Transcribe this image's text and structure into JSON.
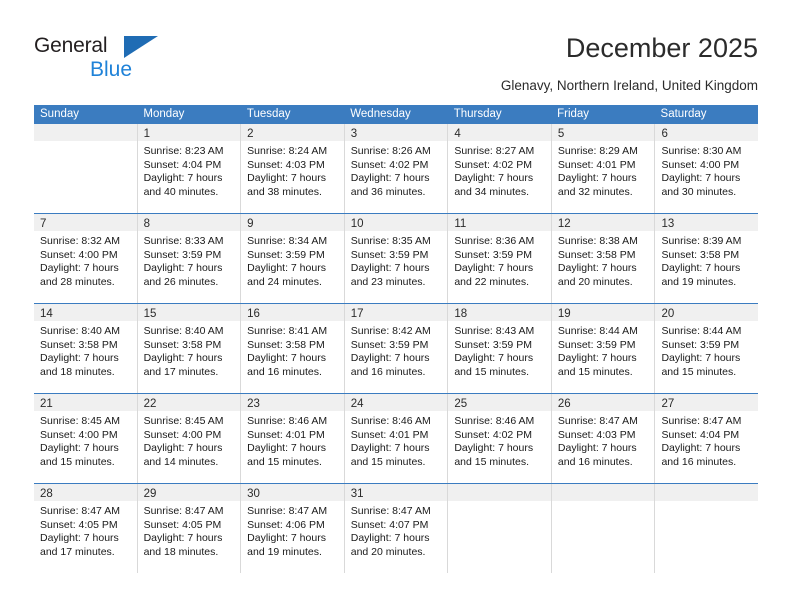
{
  "brand": {
    "name_part1": "General",
    "name_part2": "Blue",
    "primary_color": "#1f6cb4",
    "accent_color": "#1f82d8"
  },
  "header": {
    "title": "December 2025",
    "location": "Glenavy, Northern Ireland, United Kingdom"
  },
  "calendar": {
    "header_bg": "#3b7cc0",
    "header_text_color": "#ffffff",
    "daynum_bg": "#f0f0f0",
    "weekdays": [
      "Sunday",
      "Monday",
      "Tuesday",
      "Wednesday",
      "Thursday",
      "Friday",
      "Saturday"
    ],
    "weeks": [
      [
        {
          "day": "",
          "lines": []
        },
        {
          "day": "1",
          "lines": [
            "Sunrise: 8:23 AM",
            "Sunset: 4:04 PM",
            "Daylight: 7 hours",
            "and 40 minutes."
          ]
        },
        {
          "day": "2",
          "lines": [
            "Sunrise: 8:24 AM",
            "Sunset: 4:03 PM",
            "Daylight: 7 hours",
            "and 38 minutes."
          ]
        },
        {
          "day": "3",
          "lines": [
            "Sunrise: 8:26 AM",
            "Sunset: 4:02 PM",
            "Daylight: 7 hours",
            "and 36 minutes."
          ]
        },
        {
          "day": "4",
          "lines": [
            "Sunrise: 8:27 AM",
            "Sunset: 4:02 PM",
            "Daylight: 7 hours",
            "and 34 minutes."
          ]
        },
        {
          "day": "5",
          "lines": [
            "Sunrise: 8:29 AM",
            "Sunset: 4:01 PM",
            "Daylight: 7 hours",
            "and 32 minutes."
          ]
        },
        {
          "day": "6",
          "lines": [
            "Sunrise: 8:30 AM",
            "Sunset: 4:00 PM",
            "Daylight: 7 hours",
            "and 30 minutes."
          ]
        }
      ],
      [
        {
          "day": "7",
          "lines": [
            "Sunrise: 8:32 AM",
            "Sunset: 4:00 PM",
            "Daylight: 7 hours",
            "and 28 minutes."
          ]
        },
        {
          "day": "8",
          "lines": [
            "Sunrise: 8:33 AM",
            "Sunset: 3:59 PM",
            "Daylight: 7 hours",
            "and 26 minutes."
          ]
        },
        {
          "day": "9",
          "lines": [
            "Sunrise: 8:34 AM",
            "Sunset: 3:59 PM",
            "Daylight: 7 hours",
            "and 24 minutes."
          ]
        },
        {
          "day": "10",
          "lines": [
            "Sunrise: 8:35 AM",
            "Sunset: 3:59 PM",
            "Daylight: 7 hours",
            "and 23 minutes."
          ]
        },
        {
          "day": "11",
          "lines": [
            "Sunrise: 8:36 AM",
            "Sunset: 3:59 PM",
            "Daylight: 7 hours",
            "and 22 minutes."
          ]
        },
        {
          "day": "12",
          "lines": [
            "Sunrise: 8:38 AM",
            "Sunset: 3:58 PM",
            "Daylight: 7 hours",
            "and 20 minutes."
          ]
        },
        {
          "day": "13",
          "lines": [
            "Sunrise: 8:39 AM",
            "Sunset: 3:58 PM",
            "Daylight: 7 hours",
            "and 19 minutes."
          ]
        }
      ],
      [
        {
          "day": "14",
          "lines": [
            "Sunrise: 8:40 AM",
            "Sunset: 3:58 PM",
            "Daylight: 7 hours",
            "and 18 minutes."
          ]
        },
        {
          "day": "15",
          "lines": [
            "Sunrise: 8:40 AM",
            "Sunset: 3:58 PM",
            "Daylight: 7 hours",
            "and 17 minutes."
          ]
        },
        {
          "day": "16",
          "lines": [
            "Sunrise: 8:41 AM",
            "Sunset: 3:58 PM",
            "Daylight: 7 hours",
            "and 16 minutes."
          ]
        },
        {
          "day": "17",
          "lines": [
            "Sunrise: 8:42 AM",
            "Sunset: 3:59 PM",
            "Daylight: 7 hours",
            "and 16 minutes."
          ]
        },
        {
          "day": "18",
          "lines": [
            "Sunrise: 8:43 AM",
            "Sunset: 3:59 PM",
            "Daylight: 7 hours",
            "and 15 minutes."
          ]
        },
        {
          "day": "19",
          "lines": [
            "Sunrise: 8:44 AM",
            "Sunset: 3:59 PM",
            "Daylight: 7 hours",
            "and 15 minutes."
          ]
        },
        {
          "day": "20",
          "lines": [
            "Sunrise: 8:44 AM",
            "Sunset: 3:59 PM",
            "Daylight: 7 hours",
            "and 15 minutes."
          ]
        }
      ],
      [
        {
          "day": "21",
          "lines": [
            "Sunrise: 8:45 AM",
            "Sunset: 4:00 PM",
            "Daylight: 7 hours",
            "and 15 minutes."
          ]
        },
        {
          "day": "22",
          "lines": [
            "Sunrise: 8:45 AM",
            "Sunset: 4:00 PM",
            "Daylight: 7 hours",
            "and 14 minutes."
          ]
        },
        {
          "day": "23",
          "lines": [
            "Sunrise: 8:46 AM",
            "Sunset: 4:01 PM",
            "Daylight: 7 hours",
            "and 15 minutes."
          ]
        },
        {
          "day": "24",
          "lines": [
            "Sunrise: 8:46 AM",
            "Sunset: 4:01 PM",
            "Daylight: 7 hours",
            "and 15 minutes."
          ]
        },
        {
          "day": "25",
          "lines": [
            "Sunrise: 8:46 AM",
            "Sunset: 4:02 PM",
            "Daylight: 7 hours",
            "and 15 minutes."
          ]
        },
        {
          "day": "26",
          "lines": [
            "Sunrise: 8:47 AM",
            "Sunset: 4:03 PM",
            "Daylight: 7 hours",
            "and 16 minutes."
          ]
        },
        {
          "day": "27",
          "lines": [
            "Sunrise: 8:47 AM",
            "Sunset: 4:04 PM",
            "Daylight: 7 hours",
            "and 16 minutes."
          ]
        }
      ],
      [
        {
          "day": "28",
          "lines": [
            "Sunrise: 8:47 AM",
            "Sunset: 4:05 PM",
            "Daylight: 7 hours",
            "and 17 minutes."
          ]
        },
        {
          "day": "29",
          "lines": [
            "Sunrise: 8:47 AM",
            "Sunset: 4:05 PM",
            "Daylight: 7 hours",
            "and 18 minutes."
          ]
        },
        {
          "day": "30",
          "lines": [
            "Sunrise: 8:47 AM",
            "Sunset: 4:06 PM",
            "Daylight: 7 hours",
            "and 19 minutes."
          ]
        },
        {
          "day": "31",
          "lines": [
            "Sunrise: 8:47 AM",
            "Sunset: 4:07 PM",
            "Daylight: 7 hours",
            "and 20 minutes."
          ]
        },
        {
          "day": "",
          "lines": []
        },
        {
          "day": "",
          "lines": []
        },
        {
          "day": "",
          "lines": []
        }
      ]
    ]
  }
}
